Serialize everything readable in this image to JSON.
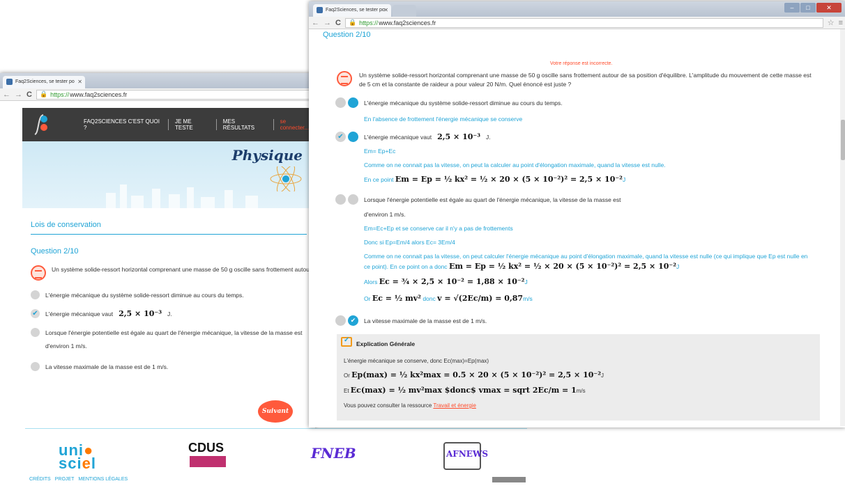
{
  "back_window": {
    "tab_title": "Faq2Sciences, se tester po",
    "url_https": "https://",
    "url_host": "www.faq2sciences.fr",
    "nav": [
      "FAQ2SCIENCES C'EST QUOI ?",
      "JE ME TESTE",
      "MES RÉSULTATS",
      "se connecter..."
    ],
    "banner_title": "Physique",
    "section_title": "Lois de conservation",
    "question_label": "Question 2/10",
    "question_text": "Un système solide-ressort horizontal comprenant une masse de 50 g oscille sans frottement autour de sa position d'équilibre. L'amplitude du mouvement de cette masse est de 5 cm et la constante de raideur a pour valeur 20 N/m. Quel énoncé est juste ?",
    "options": [
      "L'énergie mécanique du système solide-ressort diminue au cours du temps.",
      "L'énergie mécanique vaut",
      "Lorsque l'énergie potentielle est égale au quart de l'énergie mécanique, la vitesse de la masse est",
      "d'environ 1 m/s.",
      "La vitesse maximale de la masse est de 1 m/s."
    ],
    "option2_value": "2,5 × 10⁻³",
    "option2_unit": "J.",
    "next_button": "Suivant"
  },
  "footer": {
    "logos": [
      "uni scie",
      "CDUS",
      "FNEB",
      "AFNEWS"
    ],
    "links": [
      "CRÉDITS",
      "PROJET",
      "MENTIONS LÉGALES"
    ]
  },
  "front_window": {
    "tab_title": "Faq2Sciences, se tester po",
    "url_https": "https://",
    "url_host": "www.faq2sciences.fr",
    "question_label": "Question 2/10",
    "feedback": "Votre réponse est incorrecte.",
    "question_text": "Un système solide-ressort horizontal comprenant une masse de 50 g oscille sans frottement autour de sa position d'équilibre. L'amplitude du mouvement de cette masse est de 5 cm et la constante de raideur a pour valeur 20 N/m. Quel énoncé est juste ?",
    "opt1": "L'énergie mécanique du système solide-ressort diminue au cours du temps.",
    "opt1_expl": "En l'absence de frottement l'énergie mécanique se conserve",
    "opt2": "L'énergie mécanique vaut",
    "opt2_value": "2,5 × 10⁻³",
    "opt2_unit": "J.",
    "opt2_expl1": "Em= Ep+Ec",
    "opt2_expl2": "Comme on ne connait pas la vitesse, on peut la calculer au point d'élongation maximale, quand la vitesse est nulle.",
    "opt2_expl3_prefix": "En ce point",
    "opt2_expl3_math": "Em = Ep = ½ kx² = ½ × 20 × (5 × 10⁻²)² = 2,5 × 10⁻²",
    "opt2_expl3_unit": "J",
    "opt3_line1": "Lorsque l'énergie potentielle est égale au quart de l'énergie mécanique, la vitesse de la masse est",
    "opt3_line2": "d'environ 1 m/s.",
    "opt3_expl1": "Em=Ec+Ep et se conserve car il n'y a pas de frottements",
    "opt3_expl2": "Donc si Ep=Em/4 alors Ec= 3Em/4",
    "opt3_expl3": "Comme on ne connait pas la vitesse, on peut calculer l'énergie mécanique au point d'élongation maximale, quand la vitesse est nulle (ce qui implique que Ep est nulle en",
    "opt3_expl4_prefix": "ce point). En ce point on a donc",
    "opt3_expl4_math": "Em = Ep = ½ kx² = ½ × 20 × (5 × 10⁻²)² = 2,5 × 10⁻²",
    "opt3_expl4_unit": "J",
    "opt3_expl5_prefix": "Alors",
    "opt3_expl5_math": "Ec = ¾ × 2,5 × 10⁻² = 1,88 × 10⁻²",
    "opt3_expl5_unit": "J",
    "opt3_expl6_prefix": "Or",
    "opt3_expl6_math1": "Ec = ½ mv²",
    "opt3_expl6_mid": "donc",
    "opt3_expl6_math2": "v = √(2Ec/m) = 0,87",
    "opt3_expl6_unit": "m/s",
    "opt4": "La vitesse maximale de la masse est de 1 m/s.",
    "explication_title": "Explication Générale",
    "expl_line1": "L'énergie mécanique se conserve, donc Ec(max)=Ep(max)",
    "expl_line2_prefix": "Or",
    "expl_line2_math": "Ep(max) = ½ kx²max = 0.5 × 20 × (5 × 10⁻²)² = 2,5 × 10⁻²",
    "expl_line2_unit": "J",
    "expl_line3_prefix": "Et",
    "expl_line3_math": "Ec(max) = ½ mv²max $donc$ vmax = sqrt 2Ec/m = 1",
    "expl_line3_unit": "m/s",
    "expl_line4_prefix": "Vous pouvez consulter la ressource",
    "expl_line4_link": "Travail et énergie"
  }
}
